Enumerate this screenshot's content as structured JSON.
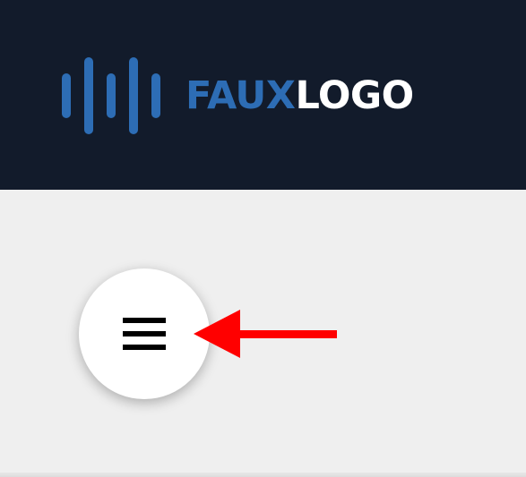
{
  "header": {
    "background": "#121b2b",
    "logo": {
      "text_part1": "FAUX",
      "text_part2": "LOGO",
      "color_part1": "#2d6db5",
      "color_part2": "#ffffff",
      "icon": "sound-wave-bars-icon"
    }
  },
  "content": {
    "background": "#efefef",
    "menu_button": {
      "icon": "hamburger-menu-icon"
    },
    "annotation": {
      "icon": "arrow-left-icon",
      "color": "#ff0000"
    }
  }
}
